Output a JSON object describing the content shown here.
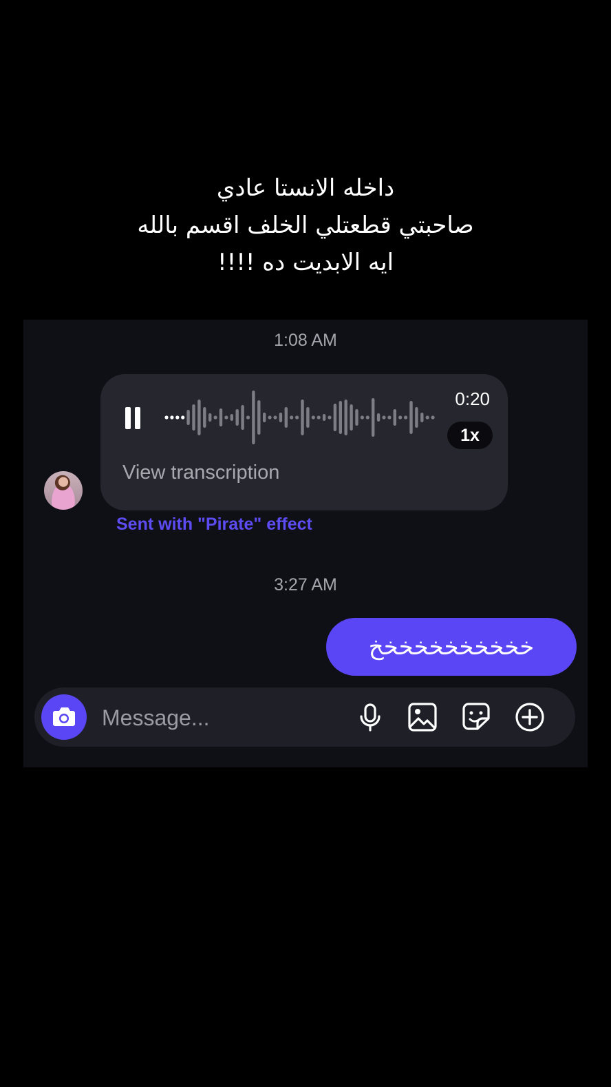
{
  "caption": {
    "line1": "داخله الانستا عادي",
    "line2": "صاحبتي قطعتلي الخلف اقسم بالله",
    "line3": "ايه الابديت ده !!!!"
  },
  "chat": {
    "timestamp_1": "1:08 AM",
    "voice_message": {
      "duration": "0:20",
      "speed": "1x",
      "view_transcription": "View transcription",
      "state": "playing"
    },
    "effect_label": "Sent with \"Pirate\" effect",
    "timestamp_2": "3:27 AM",
    "sent_message": "خخخخخخخخخخخ"
  },
  "composer": {
    "placeholder": "Message...",
    "icons": [
      "camera-icon",
      "microphone-icon",
      "gallery-icon",
      "sticker-icon",
      "plus-icon"
    ]
  },
  "colors": {
    "accent": "#5a46f5",
    "effect_text": "#5d4cf2",
    "chat_bg": "#0f1015",
    "bubble_bg": "#26272e"
  }
}
